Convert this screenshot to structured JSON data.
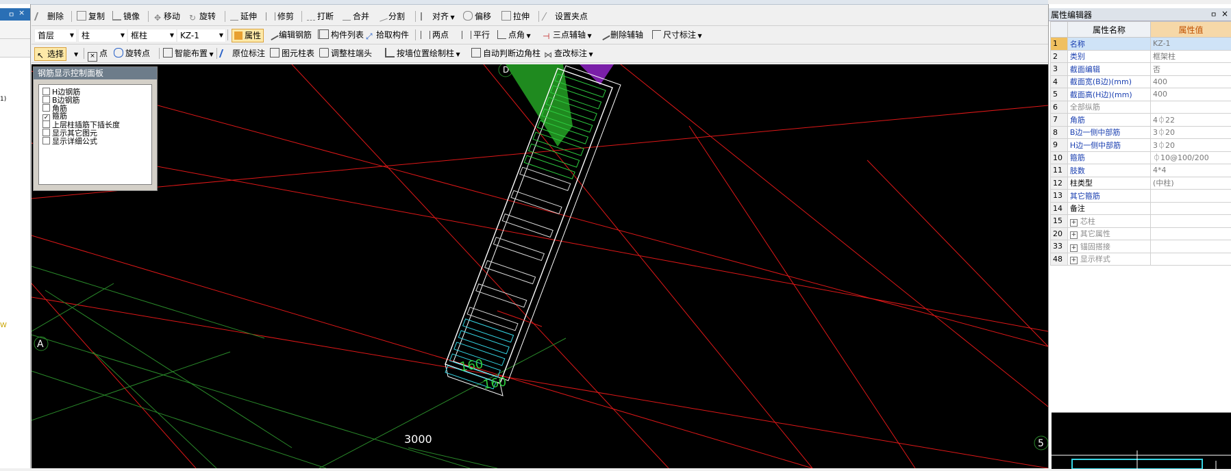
{
  "left_panel": {
    "pin": "ㅁ",
    "close": "×",
    "text1": "1)",
    "text2": "W"
  },
  "toolbar1": {
    "delete": "删除",
    "copy": "复制",
    "mirror": "镜像",
    "move": "移动",
    "rotate": "旋转",
    "extend": "延伸",
    "trim": "修剪",
    "break": "打断",
    "merge": "合并",
    "split": "分割",
    "align": "对齐",
    "offset": "偏移",
    "stretch": "拉伸",
    "set_point": "设置夹点"
  },
  "toolbar2": {
    "floor": "首层",
    "category": "柱",
    "subtype": "框柱",
    "component": "KZ-1",
    "properties": "属性",
    "edit_rebar": "编辑钢筋",
    "component_list": "构件列表",
    "pick_component": "拾取构件",
    "two_points": "两点",
    "parallel": "平行",
    "point_angle": "点角",
    "three_point_axis": "三点辅轴",
    "delete_axis": "删除辅轴",
    "dimension": "尺寸标注"
  },
  "toolbar3": {
    "select": "选择",
    "point": "点",
    "rotate_point": "旋转点",
    "smart_layout": "智能布置",
    "origin_label": "原位标注",
    "column_table": "图元柱表",
    "adjust_cap": "调整柱端头",
    "draw_by_wall": "按墙位置绘制柱",
    "auto_corner": "自动判断边角柱",
    "check_label": "查改标注"
  },
  "rebar_panel": {
    "title": "钢筋显示控制面板",
    "items": [
      {
        "label": "H边钢筋",
        "checked": false
      },
      {
        "label": "B边钢筋",
        "checked": false
      },
      {
        "label": "角筋",
        "checked": false
      },
      {
        "label": "箍筋",
        "checked": true
      },
      {
        "label": "上层柱插筋下插长度",
        "checked": false
      },
      {
        "label": "显示其它图元",
        "checked": false
      },
      {
        "label": "显示详细公式",
        "checked": false
      }
    ]
  },
  "canvas": {
    "axis_a": "A",
    "axis_5": "5",
    "axis_top": "D",
    "dim_3000": "3000",
    "dim_160a": "160",
    "dim_160b": "160"
  },
  "property_editor": {
    "title": "属性编辑器",
    "pin": "ㅁ",
    "close": "×",
    "col_name": "属性名称",
    "col_value": "属性值",
    "rows": [
      {
        "no": "1",
        "name": "名称",
        "value": "KZ-1"
      },
      {
        "no": "2",
        "name": "类别",
        "value": "框架柱"
      },
      {
        "no": "3",
        "name": "截面编辑",
        "value": "否"
      },
      {
        "no": "4",
        "name": "截面宽(B边)(mm)",
        "value": "400"
      },
      {
        "no": "5",
        "name": "截面高(H边)(mm)",
        "value": "400"
      },
      {
        "no": "6",
        "name": "全部纵筋",
        "value": ""
      },
      {
        "no": "7",
        "name": "角筋",
        "value": "4⏀22"
      },
      {
        "no": "8",
        "name": "B边一侧中部筋",
        "value": "3⏀20"
      },
      {
        "no": "9",
        "name": "H边一侧中部筋",
        "value": "3⏀20"
      },
      {
        "no": "10",
        "name": "箍筋",
        "value": "⏀10@100/200"
      },
      {
        "no": "11",
        "name": "肢数",
        "value": "4*4"
      },
      {
        "no": "12",
        "name": "柱类型",
        "value": "(中柱)"
      },
      {
        "no": "13",
        "name": "其它箍筋",
        "value": ""
      },
      {
        "no": "14",
        "name": "备注",
        "value": ""
      },
      {
        "no": "15",
        "name": "芯柱",
        "value": ""
      },
      {
        "no": "20",
        "name": "其它属性",
        "value": ""
      },
      {
        "no": "33",
        "name": "锚固搭接",
        "value": ""
      },
      {
        "no": "48",
        "name": "显示样式",
        "value": ""
      }
    ]
  },
  "colors": {
    "canvas_bg": "#000000",
    "axis_red": "#e01818",
    "grid_green": "#2a8a2a",
    "rebar_cyan": "#35d6e6",
    "rebar_green": "#2ecc40",
    "column_white": "#ffffff",
    "purple_cap": "#7a1fa8",
    "selection_highlight": "#fde9a8"
  }
}
